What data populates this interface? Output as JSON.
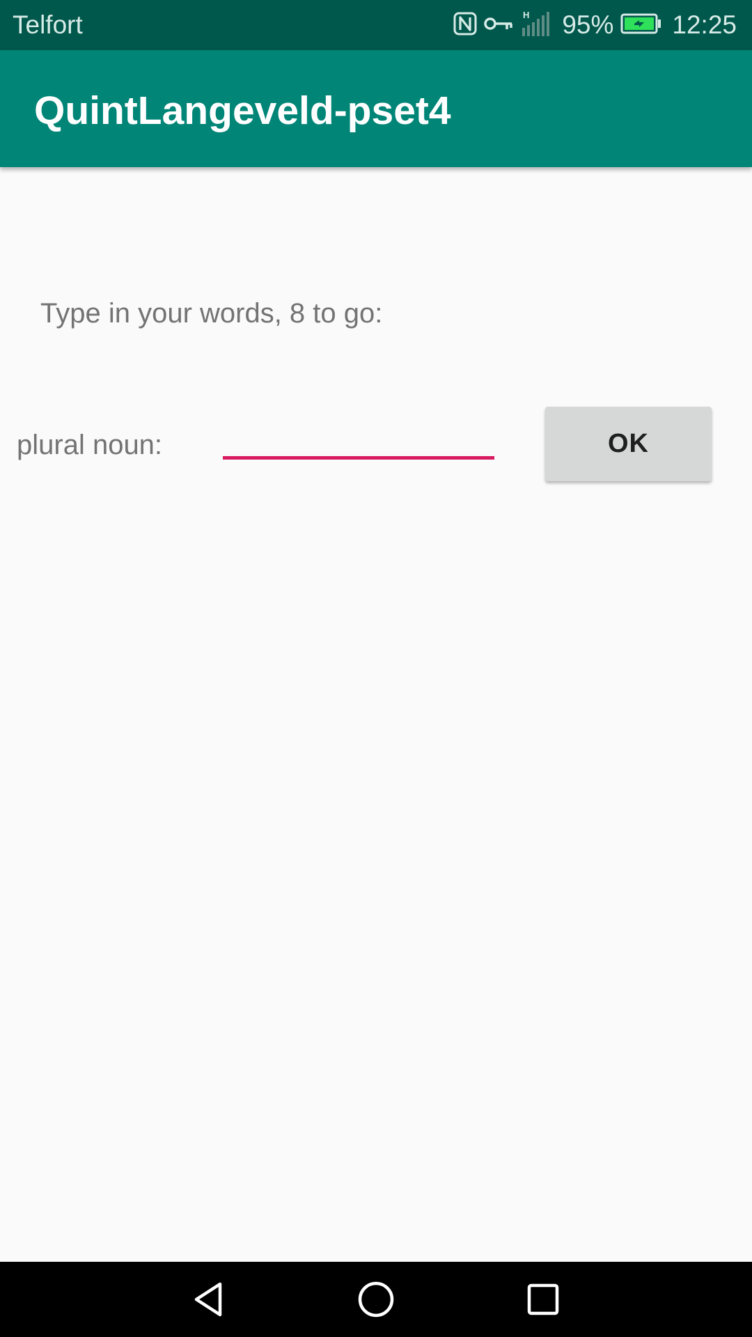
{
  "status_bar": {
    "carrier": "Telfort",
    "battery_percent": "95%",
    "time": "12:25",
    "network_type": "H",
    "icons": [
      "nfc-icon",
      "vpn-key-icon",
      "signal-icon",
      "battery-charging-icon"
    ]
  },
  "app_bar": {
    "title": "QuintLangeveld-pset4",
    "color": "#008577"
  },
  "main": {
    "prompt": "Type in your words, 8 to go:",
    "field_label": "plural noun:",
    "field_value": "",
    "ok_label": "OK",
    "accent_color": "#d81b60"
  },
  "nav_bar": {
    "buttons": [
      "back-icon",
      "home-icon",
      "recents-icon"
    ]
  }
}
